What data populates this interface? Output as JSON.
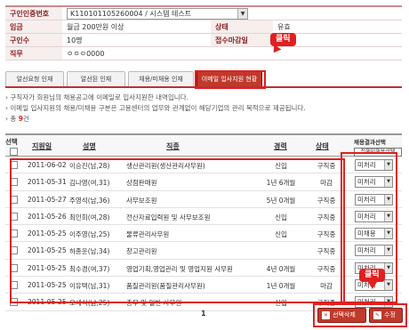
{
  "info": {
    "req_no_label": "구인인증번호",
    "req_no_value": "K110101105260004 / 시스템 테스트",
    "wage_label": "임금",
    "wage_value": "월급 200만원 이상",
    "status_label": "상태",
    "status_value": "유효",
    "count_label": "구인수",
    "count_value": "10명",
    "deadline_label": "접수마감일",
    "duty_label": "직무",
    "duty_value": "ㅇㅇㅇ0000"
  },
  "callouts": {
    "top": "클릭",
    "bottom": "클릭"
  },
  "tabs": [
    {
      "label": "알선요청 인재"
    },
    {
      "label": "알선된 인재"
    },
    {
      "label": "채용/미채용 인재"
    },
    {
      "label": "이메일 입사지원 현황"
    }
  ],
  "notes": {
    "line1": "구직자가 회원님의 채용공고에 이메일로 입사지원한 내역입니다.",
    "line2": "이메일 입사지원의 채용/미채용 구분은 고용센터의 업무와 관계없이 해당기업의 관리 목적으로 제공됩니다.",
    "total_prefix": "총 ",
    "total_count": "9",
    "total_suffix": "건"
  },
  "grid": {
    "headers": {
      "select": "선택",
      "date": "지원일",
      "name": "성명",
      "job": "직종",
      "career": "경력",
      "status": "상태",
      "result": "채용결과선택",
      "all_unprocessed": "전체미채용선택"
    },
    "rows": [
      {
        "date": "2011-06-02",
        "name": "이승진(남,28)",
        "job": "생산관리원(생산관리사무원)",
        "career": "신입",
        "status": "구직중",
        "result": "미처리"
      },
      {
        "date": "2011-05-31",
        "name": "김나영(여,31)",
        "job": "상점판매원",
        "career": "1년 6개월",
        "status": "마감",
        "result": "미처리"
      },
      {
        "date": "2011-05-27",
        "name": "주영석(남,36)",
        "job": "사무보조원",
        "career": "5년 0개월",
        "status": "구직중",
        "result": "미처리"
      },
      {
        "date": "2011-05-26",
        "name": "최인희(여,28)",
        "job": "전산자료입력원 및 사무보조원",
        "career": "신입",
        "status": "구직중",
        "result": "미처리"
      },
      {
        "date": "2011-05-25",
        "name": "이주영(남,25)",
        "job": "물류관리사무원",
        "career": "신입",
        "status": "구직중",
        "result": "미채용"
      },
      {
        "date": "2011-05-25",
        "name": "하종운(남,34)",
        "job": "창고관리원",
        "career": "",
        "status": "구직중",
        "result": "미처리"
      },
      {
        "date": "2011-05-25",
        "name": "최수경(여,37)",
        "job": "영업기획,영업관리 및 영업지원 사무원",
        "career": "4년 0개월",
        "status": "구직중",
        "result": "미처리"
      },
      {
        "date": "2011-05-25",
        "name": "이유택(남,31)",
        "job": "품질관리원(품질관리사무원)",
        "career": "1년 0개월",
        "status": "마감",
        "result": "미처리"
      },
      {
        "date": "2011-05-25",
        "name": "오세식(남,25)",
        "job": "총무 및 일반 사무원",
        "career": "신입",
        "status": "구직중",
        "result": "미처리"
      }
    ]
  },
  "pager": {
    "current": "1"
  },
  "buttons": {
    "delete": "선택삭제",
    "edit": "수정"
  },
  "colors": {
    "accent": "#c0392b",
    "highlight": "#e02020"
  }
}
